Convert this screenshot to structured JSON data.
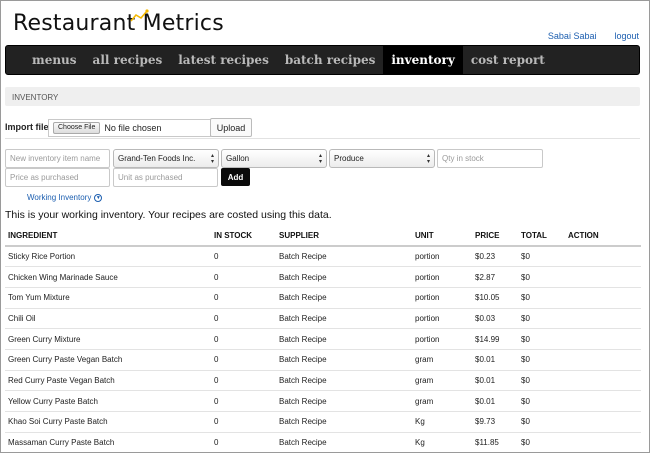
{
  "brand": {
    "name": "Restaurant Metrics"
  },
  "user": {
    "name": "Sabai Sabai",
    "logout": "logout"
  },
  "nav": {
    "items": [
      {
        "label": "menus"
      },
      {
        "label": "all recipes"
      },
      {
        "label": "latest recipes"
      },
      {
        "label": "batch recipes"
      },
      {
        "label": "inventory",
        "active": true
      },
      {
        "label": "cost report"
      }
    ]
  },
  "section": {
    "title": "INVENTORY"
  },
  "import": {
    "label": "Import file",
    "choose_label": "Choose File",
    "file_status": "No file chosen",
    "upload_label": "Upload"
  },
  "form": {
    "name_placeholder": "New inventory item name",
    "supplier_value": "Grand-Ten Foods Inc.",
    "unit_value": "Gallon",
    "category_value": "Produce",
    "qty_placeholder": "Qty in stock",
    "price_placeholder": "Price as purchased",
    "unit_purchased_placeholder": "Unit as purchased",
    "add_label": "Add"
  },
  "working_link": "Working Inventory",
  "intro_text": "This is your working inventory. Your recipes are costed using this data.",
  "table": {
    "headers": [
      "INGREDIENT",
      "IN STOCK",
      "SUPPLIER",
      "UNIT",
      "PRICE",
      "TOTAL",
      "ACTION"
    ],
    "rows": [
      [
        "Sticky Rice Portion",
        "0",
        "Batch Recipe",
        "portion",
        "$0.23",
        "$0",
        ""
      ],
      [
        "Chicken Wing Marinade Sauce",
        "0",
        "Batch Recipe",
        "portion",
        "$2.87",
        "$0",
        ""
      ],
      [
        "Tom Yum Mixture",
        "0",
        "Batch Recipe",
        "portion",
        "$10.05",
        "$0",
        ""
      ],
      [
        "Chili Oil",
        "0",
        "Batch Recipe",
        "portion",
        "$0.03",
        "$0",
        ""
      ],
      [
        "Green Curry Mixture",
        "0",
        "Batch Recipe",
        "portion",
        "$14.99",
        "$0",
        ""
      ],
      [
        "Green Curry Paste Vegan Batch",
        "0",
        "Batch Recipe",
        "gram",
        "$0.01",
        "$0",
        ""
      ],
      [
        "Red Curry Paste Vegan Batch",
        "0",
        "Batch Recipe",
        "gram",
        "$0.01",
        "$0",
        ""
      ],
      [
        "Yellow Curry Paste Batch",
        "0",
        "Batch Recipe",
        "gram",
        "$0.01",
        "$0",
        ""
      ],
      [
        "Khao Soi Curry Paste Batch",
        "0",
        "Batch Recipe",
        "Kg",
        "$9.73",
        "$0",
        ""
      ],
      [
        "Massaman Curry Paste Batch",
        "0",
        "Batch Recipe",
        "Kg",
        "$11.85",
        "$0",
        ""
      ]
    ]
  },
  "colors": {
    "nav_bg": "#222222",
    "nav_active": "#000000",
    "link": "#1d5fb0",
    "brand_accent": "#f5b800"
  }
}
